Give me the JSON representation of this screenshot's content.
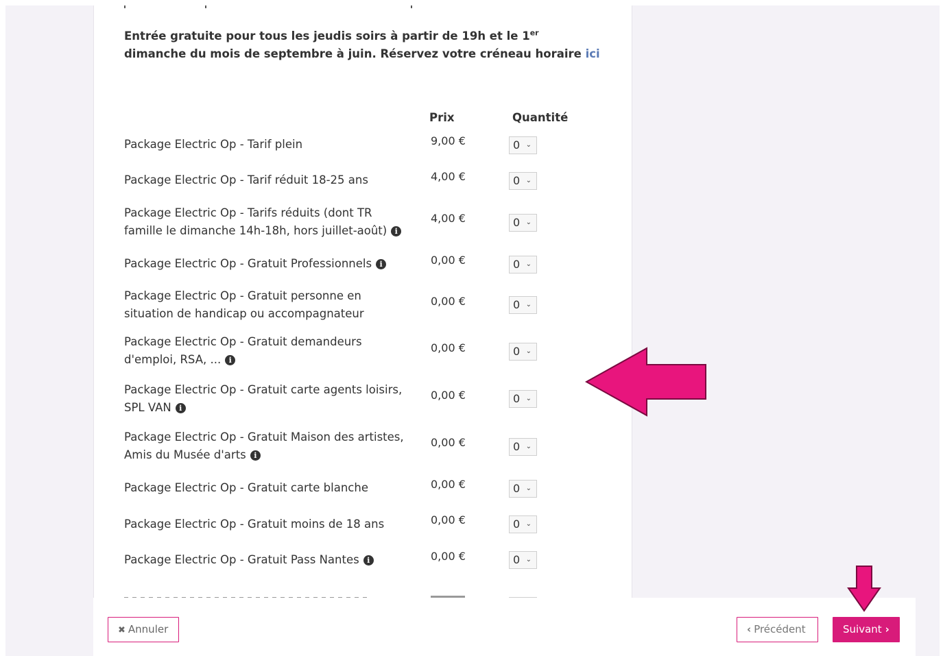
{
  "notice": {
    "text_before_sup": "Entrée gratuite pour tous les jeudis soirs à partir de 19h et le 1",
    "sup": "er",
    "text_after_sup": " dimanche du mois de septembre à juin. Réservez votre créneau horaire ",
    "link": "ici"
  },
  "table": {
    "price_header": "Prix",
    "quantity_header": "Quantité",
    "rows": [
      {
        "label": "Package Electric Op - Tarif plein",
        "price": "9,00 €",
        "qty": "0",
        "info": false
      },
      {
        "label": "Package Electric Op - Tarif réduit 18-25 ans",
        "price": "4,00 €",
        "qty": "0",
        "info": false
      },
      {
        "label": "Package Electric Op - Tarifs réduits (dont TR famille le dimanche 14h-18h, hors juillet-août)",
        "price": "4,00 €",
        "qty": "0",
        "info": true
      },
      {
        "label": "Package Electric Op - Gratuit Professionnels",
        "price": "0,00 €",
        "qty": "0",
        "info": true
      },
      {
        "label": "Package Electric Op - Gratuit personne en situation de handicap ou accompagnateur",
        "price": "0,00 €",
        "qty": "0",
        "info": false
      },
      {
        "label": "Package Electric Op - Gratuit demandeurs d'emploi, RSA, ...",
        "price": "0,00 €",
        "qty": "0",
        "info": true
      },
      {
        "label": "Package Electric Op - Gratuit carte agents loisirs, SPL VAN",
        "price": "0,00 €",
        "qty": "0",
        "info": true
      },
      {
        "label": "Package Electric Op - Gratuit Maison des artistes, Amis du Musée d'arts",
        "price": "0,00 €",
        "qty": "0",
        "info": true
      },
      {
        "label": "Package Electric Op - Gratuit carte blanche",
        "price": "0,00 €",
        "qty": "0",
        "info": false
      },
      {
        "label": "Package Electric Op - Gratuit moins de 18 ans",
        "price": "0,00 €",
        "qty": "0",
        "info": false
      },
      {
        "label": "Package Electric Op - Gratuit Pass Nantes",
        "price": "0,00 €",
        "qty": "0",
        "info": true
      }
    ],
    "info_glyph": "i"
  },
  "footer": {
    "cancel_label": "Annuler",
    "previous_label": "Précédent",
    "next_label": "Suivant"
  },
  "icons": {
    "cancel": "close-icon",
    "previous": "chevron-left-icon",
    "next": "chevron-right-icon",
    "qty": "chevron-down-icon",
    "info": "info-circle-icon"
  },
  "colors": {
    "accent": "#d81b7a",
    "annotation_arrow": "#e8157d",
    "link": "#5b7bb5"
  }
}
